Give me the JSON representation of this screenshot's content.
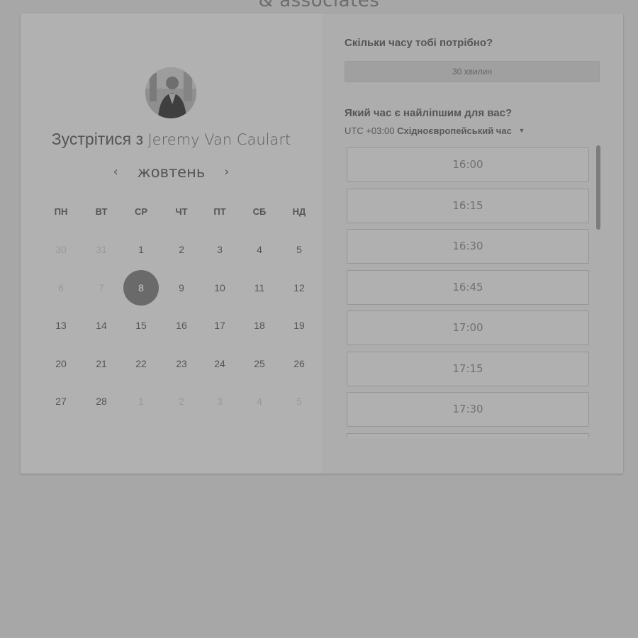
{
  "brand": {
    "text": "& associates"
  },
  "left": {
    "avatar_icon": "person-photo",
    "title_prefix": "Зустрітися з",
    "host_name": "Jeremy Van Caulart",
    "month": "жовтень",
    "prev_icon": "chevron-left",
    "next_icon": "chevron-right",
    "weekdays": [
      "ПН",
      "ВТ",
      "СР",
      "ЧТ",
      "ПТ",
      "СБ",
      "НД"
    ],
    "weeks": [
      [
        {
          "d": "30",
          "m": true
        },
        {
          "d": "31",
          "m": true
        },
        {
          "d": "1"
        },
        {
          "d": "2"
        },
        {
          "d": "3"
        },
        {
          "d": "4"
        },
        {
          "d": "5"
        }
      ],
      [
        {
          "d": "6",
          "m": true
        },
        {
          "d": "7",
          "m": true
        },
        {
          "d": "8",
          "s": true
        },
        {
          "d": "9"
        },
        {
          "d": "10"
        },
        {
          "d": "11"
        },
        {
          "d": "12"
        }
      ],
      [
        {
          "d": "13"
        },
        {
          "d": "14"
        },
        {
          "d": "15"
        },
        {
          "d": "16"
        },
        {
          "d": "17"
        },
        {
          "d": "18"
        },
        {
          "d": "19"
        }
      ],
      [
        {
          "d": "20"
        },
        {
          "d": "21"
        },
        {
          "d": "22"
        },
        {
          "d": "23"
        },
        {
          "d": "24"
        },
        {
          "d": "25"
        },
        {
          "d": "26"
        }
      ],
      [
        {
          "d": "27"
        },
        {
          "d": "28"
        },
        {
          "d": "1",
          "m": true
        },
        {
          "d": "2",
          "m": true
        },
        {
          "d": "3",
          "m": true
        },
        {
          "d": "4",
          "m": true
        },
        {
          "d": "5",
          "m": true
        }
      ]
    ]
  },
  "right": {
    "duration_question": "Скільки часу тобі потрібно?",
    "duration_value": "30 хвилин",
    "time_question": "Який час є найліпшим для вас?",
    "tz_offset": "UTC +03:00",
    "tz_name": "Східноєвропейський час",
    "slots": [
      "16:00",
      "16:15",
      "16:30",
      "16:45",
      "17:00",
      "17:15",
      "17:30",
      ""
    ]
  },
  "colors": {
    "selected_day": "#6a6a6a",
    "overlay_background": "#a7a7a7"
  }
}
